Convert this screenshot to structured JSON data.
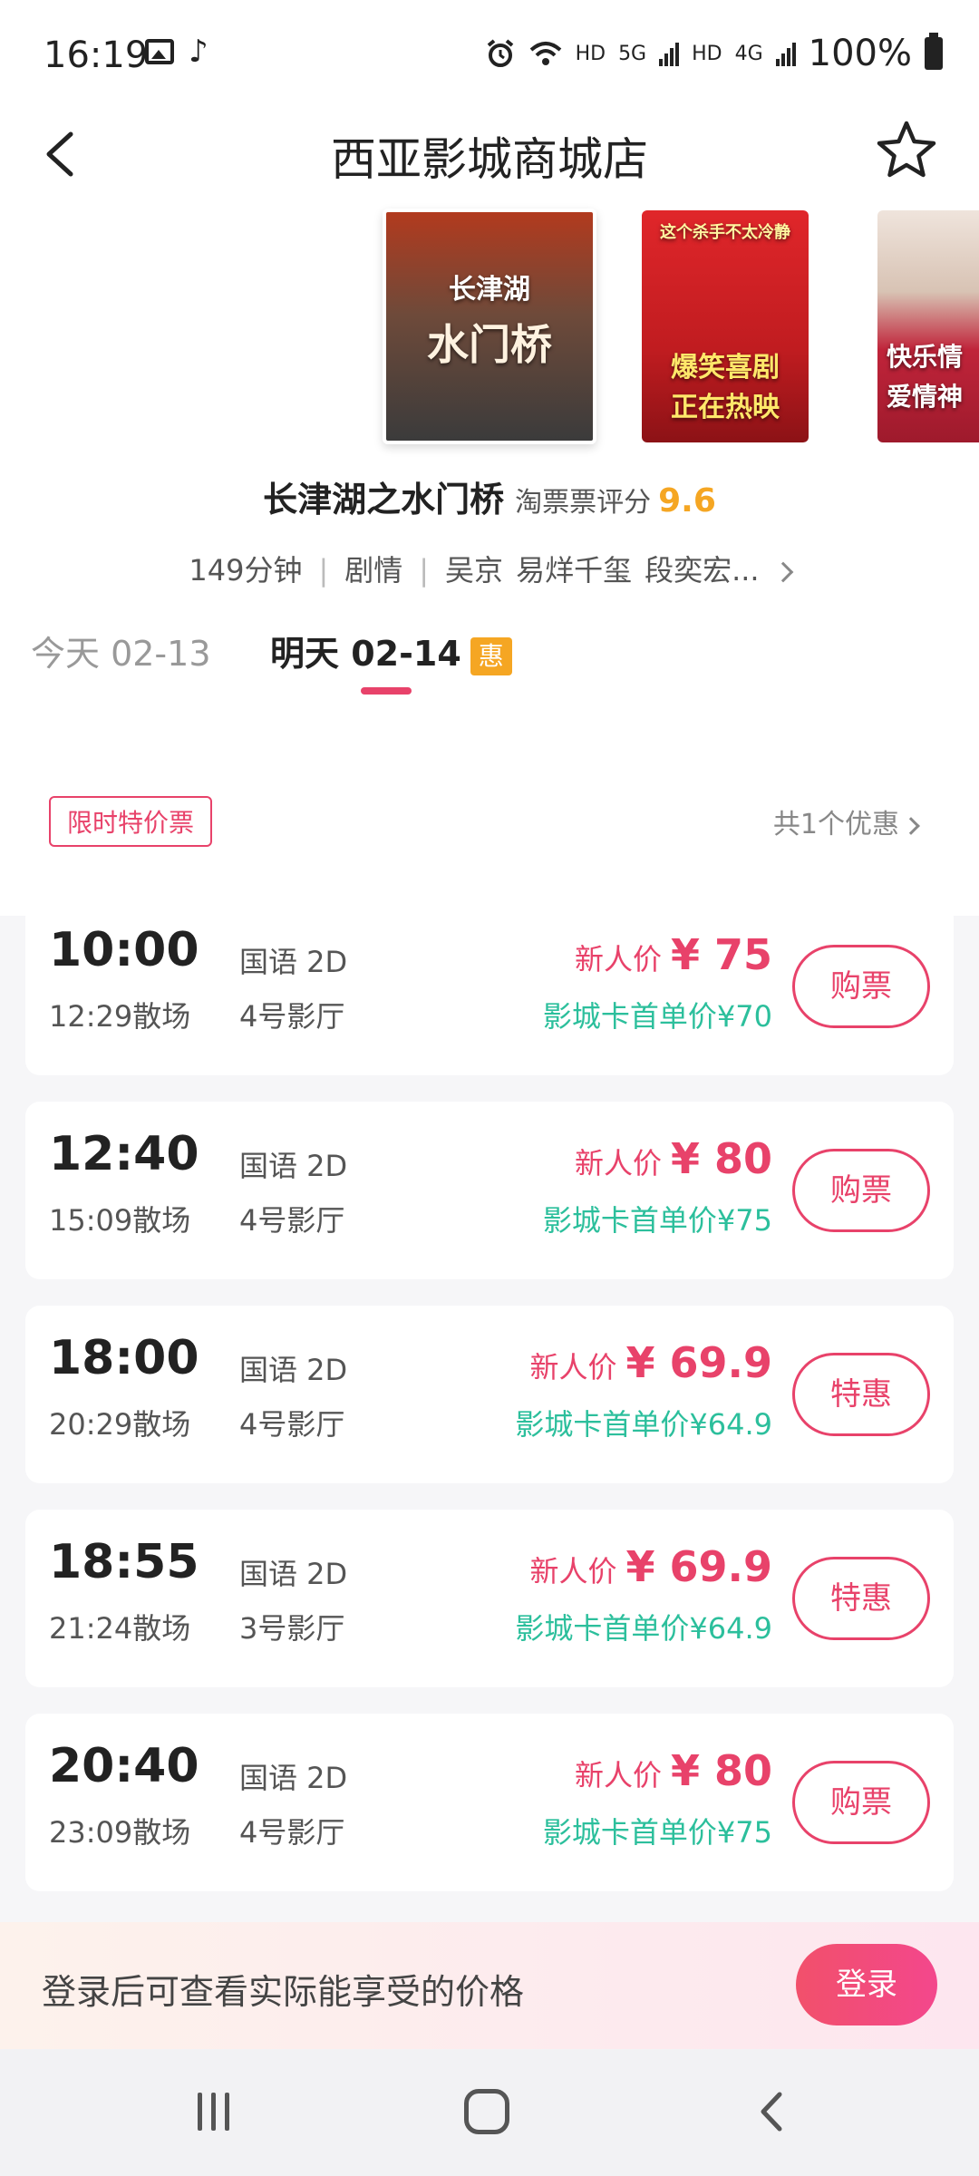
{
  "status_bar": {
    "time": "16:19",
    "network_labels": [
      "HD",
      "5G",
      "HD",
      "4G"
    ],
    "battery": "100%"
  },
  "header": {
    "title": "西亚影城商城店"
  },
  "movie": {
    "title": "长津湖之水门桥",
    "rating_label": "淘票票评分",
    "rating_value": "9.6",
    "duration": "149分钟",
    "genre": "剧情",
    "cast": [
      "吴京",
      "易烊千玺",
      "段奕宏..."
    ],
    "posters": [
      {
        "text_line1": "长津湖",
        "text_line2": "水门桥"
      },
      {
        "text_top": "这个杀手不太冷静",
        "text_line1": "爆笑喜剧",
        "text_line2": "正在热映"
      },
      {
        "text_line1": "快乐情",
        "text_line2": "爱情神"
      }
    ]
  },
  "date_tabs": [
    {
      "label": "今天 02-13",
      "active": false
    },
    {
      "label": "明天 02-14",
      "active": true,
      "badge": "惠"
    }
  ],
  "promo": {
    "tag": "限时特价票",
    "count": "共1个优惠"
  },
  "showtimes": [
    {
      "start": "10:00",
      "end": "12:29散场",
      "language": "国语 2D",
      "hall": "4号影厅",
      "price_label": "新人价",
      "price": "¥ 75",
      "card_price": "影城卡首单价¥70",
      "button": "购票"
    },
    {
      "start": "12:40",
      "end": "15:09散场",
      "language": "国语 2D",
      "hall": "4号影厅",
      "price_label": "新人价",
      "price": "¥ 80",
      "card_price": "影城卡首单价¥75",
      "button": "购票"
    },
    {
      "start": "18:00",
      "end": "20:29散场",
      "language": "国语 2D",
      "hall": "4号影厅",
      "price_label": "新人价",
      "price": "¥ 69.9",
      "card_price": "影城卡首单价¥64.9",
      "button": "特惠"
    },
    {
      "start": "18:55",
      "end": "21:24散场",
      "language": "国语 2D",
      "hall": "3号影厅",
      "price_label": "新人价",
      "price": "¥ 69.9",
      "card_price": "影城卡首单价¥64.9",
      "button": "特惠"
    },
    {
      "start": "20:40",
      "end": "23:09散场",
      "language": "国语 2D",
      "hall": "4号影厅",
      "price_label": "新人价",
      "price": "¥ 80",
      "card_price": "影城卡首单价¥75",
      "button": "购票"
    }
  ],
  "login_bar": {
    "hint": "登录后可查看实际能享受的价格",
    "button": "登录"
  },
  "colors": {
    "accent": "#e8426a",
    "rating": "#f5a623",
    "card_price": "#2cbf9c"
  },
  "icons": {
    "back": "chevron-left-icon",
    "favorite": "star-outline-icon",
    "nav_recents": "recents-icon",
    "nav_home": "home-icon",
    "nav_back": "back-icon"
  }
}
